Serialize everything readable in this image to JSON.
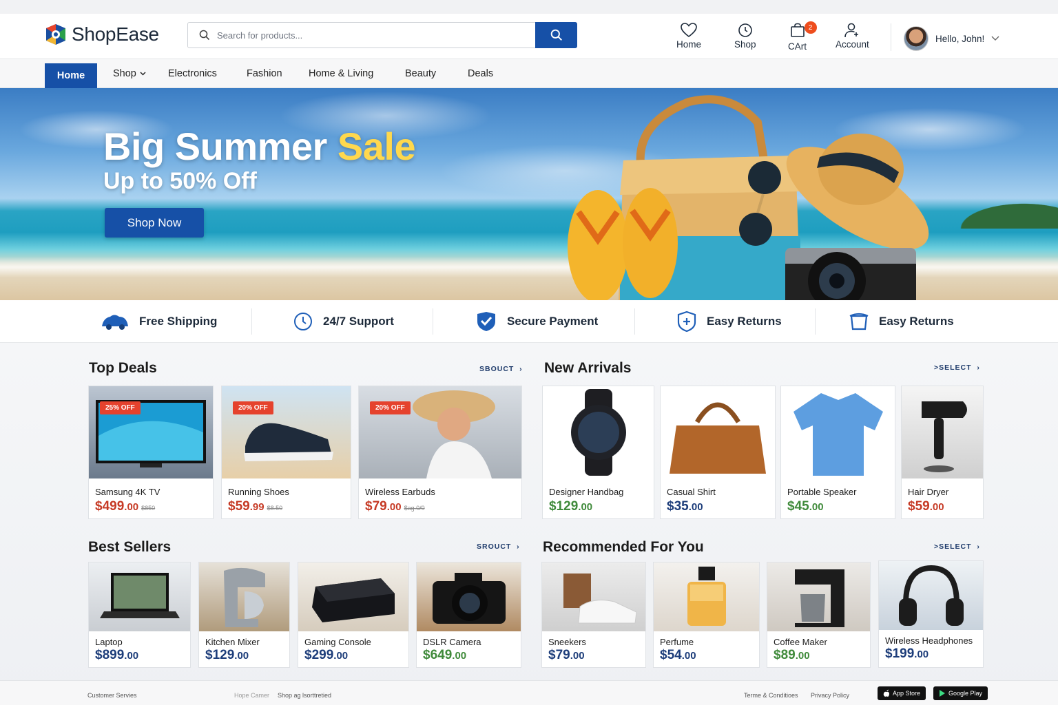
{
  "header": {
    "logo_text": "ShopEase",
    "search_placeholder": "Search for products...",
    "nav": [
      {
        "label": "Home",
        "icon": "heart-icon"
      },
      {
        "label": "Shop",
        "icon": "clock-icon"
      },
      {
        "label": "CArt",
        "icon": "cart-icon",
        "badge": "2"
      },
      {
        "label": "Account",
        "icon": "user-icon"
      }
    ],
    "greeting": "Hello, John!"
  },
  "navbar": {
    "items": [
      "Home",
      "Shop",
      "Electronics",
      "Fashion",
      "Home & Living",
      "Beauty",
      "Deals"
    ],
    "active": "Home"
  },
  "hero": {
    "title_main": "Big Summer",
    "title_highlight": "Sale",
    "subtitle": "Up to 50% Off",
    "cta": "Shop Now"
  },
  "features": [
    {
      "label": "Free Shipping",
      "icon": "truck-icon"
    },
    {
      "label": "24/7 Support",
      "icon": "support-clock-icon"
    },
    {
      "label": "Secure Payment",
      "icon": "shield-check-icon"
    },
    {
      "label": "Easy Returns",
      "icon": "shield-plus-icon"
    },
    {
      "label": "Easy Returns",
      "icon": "return-box-icon"
    }
  ],
  "sections": {
    "top_deals": {
      "title": "Top Deals",
      "link": "SBOUCT",
      "items": [
        {
          "name": "Samsung 4K TV",
          "price": "$499",
          "cents": ".00",
          "old": "$850",
          "badge": "25% OFF"
        },
        {
          "name": "Running Shoes",
          "price": "$59",
          "cents": ".99",
          "old": "$8.50",
          "badge": "20% OFF"
        },
        {
          "name": "Wireless Earbuds",
          "price": "$79",
          "cents": ".00",
          "old": "$ag.0/0",
          "badge": "20% OFF"
        }
      ]
    },
    "new_arrivals": {
      "title": "New Arrivals",
      "link": ">SELECT",
      "items": [
        {
          "name": "Designer Handbag",
          "price": "$129",
          "cents": ".00"
        },
        {
          "name": "Casual Shirt",
          "price": "$35",
          "cents": ".00"
        },
        {
          "name": "Portable Speaker",
          "price": "$45",
          "cents": ".00"
        },
        {
          "name": "Hair Dryer",
          "price": "$59",
          "cents": ".00"
        }
      ]
    },
    "best_sellers": {
      "title": "Best Sellers",
      "link": "SROUCT",
      "items": [
        {
          "name": "Laptop",
          "price": "$899",
          "cents": ".00"
        },
        {
          "name": "Kitchen Mixer",
          "price": "$129",
          "cents": ".00"
        },
        {
          "name": "Gaming Console",
          "price": "$299",
          "cents": ".00"
        },
        {
          "name": "DSLR Camera",
          "price": "$649",
          "cents": ".00"
        }
      ]
    },
    "recommended": {
      "title": "Recommended For You",
      "link": ">SELECT",
      "items": [
        {
          "name": "Sneekers",
          "price": "$79",
          "cents": ".00"
        },
        {
          "name": "Perfume",
          "price": "$54",
          "cents": ".00"
        },
        {
          "name": "Coffee  Maker",
          "price": "$89",
          "cents": ".00"
        },
        {
          "name": "Wireless Headphones",
          "price": "$199",
          "cents": ".00"
        }
      ]
    }
  },
  "footer": {
    "links": [
      "Customer Servies",
      "Hope Camer",
      "Shop ag lsorttretied",
      "Terme & Conditioes",
      "Privacy Policy"
    ],
    "app_store": "App Store",
    "google_play": "Google Play"
  },
  "colors": {
    "primary": "#1650a7",
    "sale_yellow": "#ffd84d",
    "badge_red": "#e5422d",
    "price_red": "#c63a25",
    "price_green": "#3f8a3a",
    "price_navy": "#1d3d7a"
  }
}
